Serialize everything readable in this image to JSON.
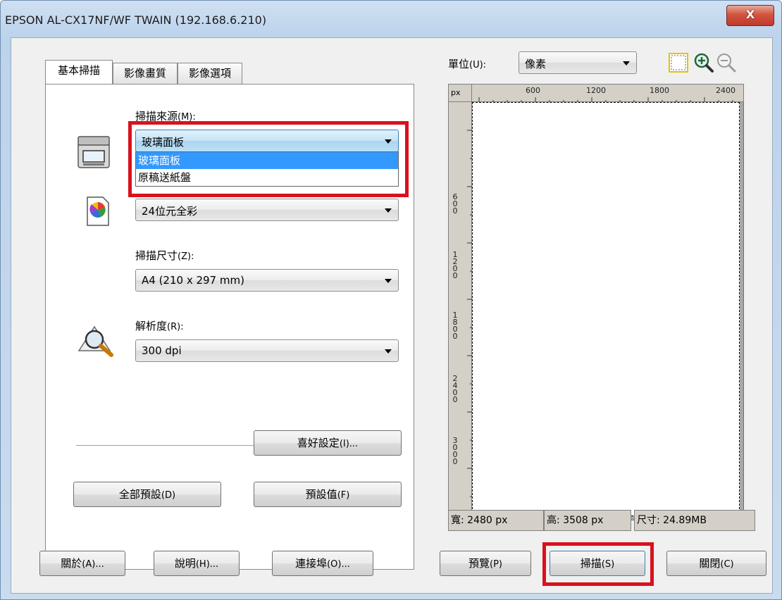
{
  "window": {
    "title": "EPSON AL-CX17NF/WF TWAIN (192.168.6.210)",
    "close_label": "X"
  },
  "tabs": [
    "基本掃描",
    "影像畫質",
    "影像選項"
  ],
  "basic": {
    "source": {
      "label": "掃描來源",
      "accel": "(M):",
      "value": "玻璃面板",
      "options": [
        "玻璃面板",
        "原稿送紙盤"
      ]
    },
    "color": {
      "value": "24位元全彩"
    },
    "size": {
      "label": "掃描尺寸",
      "accel": "(Z):",
      "value": "A4 (210 x 297 mm)"
    },
    "resolution": {
      "label": "解析度",
      "accel": "(R):",
      "value": "300 dpi"
    },
    "favorites_button": {
      "label": "喜好設定",
      "accel": "(I)..."
    },
    "reset_all_button": {
      "label": "全部預設",
      "accel": "(D)"
    },
    "defaults_button": {
      "label": "預設值",
      "accel": "(F)"
    }
  },
  "preview": {
    "unit": {
      "label": "單位",
      "accel": "(U):",
      "value": "像素"
    },
    "ruler_unit": "px",
    "h_ticks": [
      "600",
      "1200",
      "1800",
      "2400"
    ],
    "v_ticks": [
      "600",
      "1200",
      "1800",
      "2400",
      "3000"
    ],
    "status": {
      "width": "寬: 2480 px",
      "height": "高: 3508 px",
      "size": "尺寸: 24.89MB"
    }
  },
  "buttons": {
    "about": {
      "label": "關於",
      "accel": "(A)..."
    },
    "help": {
      "label": "說明",
      "accel": "(H)..."
    },
    "port": {
      "label": "連接埠",
      "accel": "(O)..."
    },
    "preview": {
      "label": "預覽",
      "accel": "(P)"
    },
    "scan": {
      "label": "掃描",
      "accel": "(S)"
    },
    "close": {
      "label": "關閉",
      "accel": "(C)"
    }
  },
  "colors": {
    "highlight": "#d9111e",
    "selection": "#3399ff"
  }
}
